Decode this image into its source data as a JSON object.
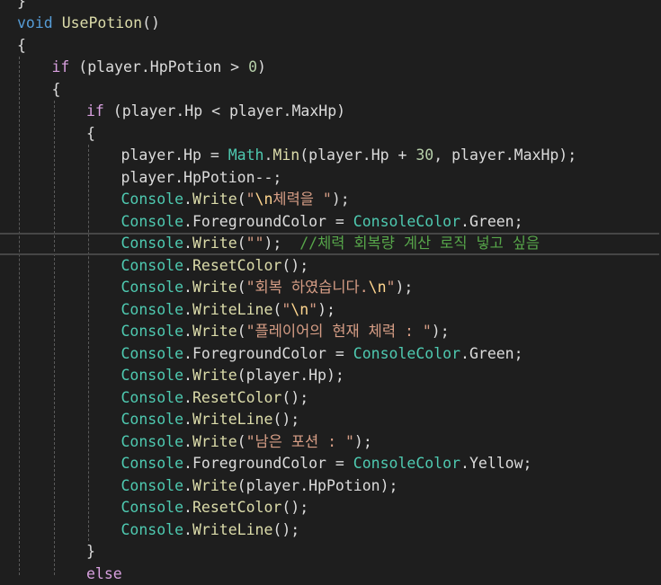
{
  "editor": {
    "lines": [
      {
        "indent": 0,
        "tokens": [
          {
            "t": "}",
            "c": "plain"
          }
        ]
      },
      {
        "indent": 0,
        "tokens": [
          {
            "t": "void",
            "c": "kw"
          },
          {
            "t": " ",
            "c": "plain"
          },
          {
            "t": "UsePotion",
            "c": "method"
          },
          {
            "t": "()",
            "c": "plain"
          }
        ]
      },
      {
        "indent": 0,
        "tokens": [
          {
            "t": "{",
            "c": "plain"
          }
        ]
      },
      {
        "indent": 1,
        "tokens": [
          {
            "t": "if",
            "c": "ctl"
          },
          {
            "t": " (player.HpPotion > ",
            "c": "plain"
          },
          {
            "t": "0",
            "c": "num"
          },
          {
            "t": ")",
            "c": "plain"
          }
        ]
      },
      {
        "indent": 1,
        "tokens": [
          {
            "t": "{",
            "c": "plain"
          }
        ]
      },
      {
        "indent": 2,
        "tokens": [
          {
            "t": "if",
            "c": "ctl"
          },
          {
            "t": " (player.Hp < player.MaxHp)",
            "c": "plain"
          }
        ]
      },
      {
        "indent": 2,
        "tokens": [
          {
            "t": "{",
            "c": "plain"
          }
        ]
      },
      {
        "indent": 3,
        "tokens": [
          {
            "t": "player.Hp = ",
            "c": "plain"
          },
          {
            "t": "Math",
            "c": "type"
          },
          {
            "t": ".",
            "c": "plain"
          },
          {
            "t": "Min",
            "c": "method"
          },
          {
            "t": "(player.Hp + ",
            "c": "plain"
          },
          {
            "t": "30",
            "c": "num"
          },
          {
            "t": ", player.MaxHp);",
            "c": "plain"
          }
        ]
      },
      {
        "indent": 3,
        "tokens": [
          {
            "t": "player.HpPotion--;",
            "c": "plain"
          }
        ]
      },
      {
        "indent": 3,
        "tokens": [
          {
            "t": "Console",
            "c": "type"
          },
          {
            "t": ".",
            "c": "plain"
          },
          {
            "t": "Write",
            "c": "method"
          },
          {
            "t": "(",
            "c": "plain"
          },
          {
            "t": "\"",
            "c": "str"
          },
          {
            "t": "\\n",
            "c": "esc"
          },
          {
            "t": "체력을 \"",
            "c": "str"
          },
          {
            "t": ");",
            "c": "plain"
          }
        ]
      },
      {
        "indent": 3,
        "tokens": [
          {
            "t": "Console",
            "c": "type"
          },
          {
            "t": ".ForegroundColor = ",
            "c": "plain"
          },
          {
            "t": "ConsoleColor",
            "c": "type"
          },
          {
            "t": ".Green;",
            "c": "plain"
          }
        ]
      },
      {
        "indent": 3,
        "current": true,
        "tokens": [
          {
            "t": "Console",
            "c": "type"
          },
          {
            "t": ".",
            "c": "plain"
          },
          {
            "t": "Write",
            "c": "method"
          },
          {
            "t": "(",
            "c": "plain"
          },
          {
            "t": "\"\"",
            "c": "str"
          },
          {
            "t": ");  ",
            "c": "plain"
          },
          {
            "t": "//체력 회복량 계산 로직 넣고 싶음",
            "c": "cmt"
          }
        ]
      },
      {
        "indent": 3,
        "tokens": [
          {
            "t": "Console",
            "c": "type"
          },
          {
            "t": ".",
            "c": "plain"
          },
          {
            "t": "ResetColor",
            "c": "method"
          },
          {
            "t": "();",
            "c": "plain"
          }
        ]
      },
      {
        "indent": 3,
        "tokens": [
          {
            "t": "Console",
            "c": "type"
          },
          {
            "t": ".",
            "c": "plain"
          },
          {
            "t": "Write",
            "c": "method"
          },
          {
            "t": "(",
            "c": "plain"
          },
          {
            "t": "\"회복 하였습니다.",
            "c": "str"
          },
          {
            "t": "\\n",
            "c": "esc"
          },
          {
            "t": "\"",
            "c": "str"
          },
          {
            "t": ");",
            "c": "plain"
          }
        ]
      },
      {
        "indent": 3,
        "tokens": [
          {
            "t": "Console",
            "c": "type"
          },
          {
            "t": ".",
            "c": "plain"
          },
          {
            "t": "WriteLine",
            "c": "method"
          },
          {
            "t": "(",
            "c": "plain"
          },
          {
            "t": "\"",
            "c": "str"
          },
          {
            "t": "\\n",
            "c": "esc"
          },
          {
            "t": "\"",
            "c": "str"
          },
          {
            "t": ");",
            "c": "plain"
          }
        ]
      },
      {
        "indent": 3,
        "tokens": [
          {
            "t": "Console",
            "c": "type"
          },
          {
            "t": ".",
            "c": "plain"
          },
          {
            "t": "Write",
            "c": "method"
          },
          {
            "t": "(",
            "c": "plain"
          },
          {
            "t": "\"플레이어의 현재 체력 : \"",
            "c": "str"
          },
          {
            "t": ");",
            "c": "plain"
          }
        ]
      },
      {
        "indent": 3,
        "tokens": [
          {
            "t": "Console",
            "c": "type"
          },
          {
            "t": ".ForegroundColor = ",
            "c": "plain"
          },
          {
            "t": "ConsoleColor",
            "c": "type"
          },
          {
            "t": ".Green;",
            "c": "plain"
          }
        ]
      },
      {
        "indent": 3,
        "tokens": [
          {
            "t": "Console",
            "c": "type"
          },
          {
            "t": ".",
            "c": "plain"
          },
          {
            "t": "Write",
            "c": "method"
          },
          {
            "t": "(player.Hp);",
            "c": "plain"
          }
        ]
      },
      {
        "indent": 3,
        "tokens": [
          {
            "t": "Console",
            "c": "type"
          },
          {
            "t": ".",
            "c": "plain"
          },
          {
            "t": "ResetColor",
            "c": "method"
          },
          {
            "t": "();",
            "c": "plain"
          }
        ]
      },
      {
        "indent": 3,
        "tokens": [
          {
            "t": "Console",
            "c": "type"
          },
          {
            "t": ".",
            "c": "plain"
          },
          {
            "t": "WriteLine",
            "c": "method"
          },
          {
            "t": "();",
            "c": "plain"
          }
        ]
      },
      {
        "indent": 3,
        "tokens": [
          {
            "t": "Console",
            "c": "type"
          },
          {
            "t": ".",
            "c": "plain"
          },
          {
            "t": "Write",
            "c": "method"
          },
          {
            "t": "(",
            "c": "plain"
          },
          {
            "t": "\"남은 포션 : \"",
            "c": "str"
          },
          {
            "t": ");",
            "c": "plain"
          }
        ]
      },
      {
        "indent": 3,
        "tokens": [
          {
            "t": "Console",
            "c": "type"
          },
          {
            "t": ".ForegroundColor = ",
            "c": "plain"
          },
          {
            "t": "ConsoleColor",
            "c": "type"
          },
          {
            "t": ".Yellow;",
            "c": "plain"
          }
        ]
      },
      {
        "indent": 3,
        "tokens": [
          {
            "t": "Console",
            "c": "type"
          },
          {
            "t": ".",
            "c": "plain"
          },
          {
            "t": "Write",
            "c": "method"
          },
          {
            "t": "(player.HpPotion);",
            "c": "plain"
          }
        ]
      },
      {
        "indent": 3,
        "tokens": [
          {
            "t": "Console",
            "c": "type"
          },
          {
            "t": ".",
            "c": "plain"
          },
          {
            "t": "ResetColor",
            "c": "method"
          },
          {
            "t": "();",
            "c": "plain"
          }
        ]
      },
      {
        "indent": 3,
        "tokens": [
          {
            "t": "Console",
            "c": "type"
          },
          {
            "t": ".",
            "c": "plain"
          },
          {
            "t": "WriteLine",
            "c": "method"
          },
          {
            "t": "();",
            "c": "plain"
          }
        ]
      },
      {
        "indent": 2,
        "tokens": [
          {
            "t": "}",
            "c": "plain"
          }
        ]
      },
      {
        "indent": 2,
        "tokens": [
          {
            "t": "else",
            "c": "ctl"
          }
        ]
      }
    ]
  }
}
